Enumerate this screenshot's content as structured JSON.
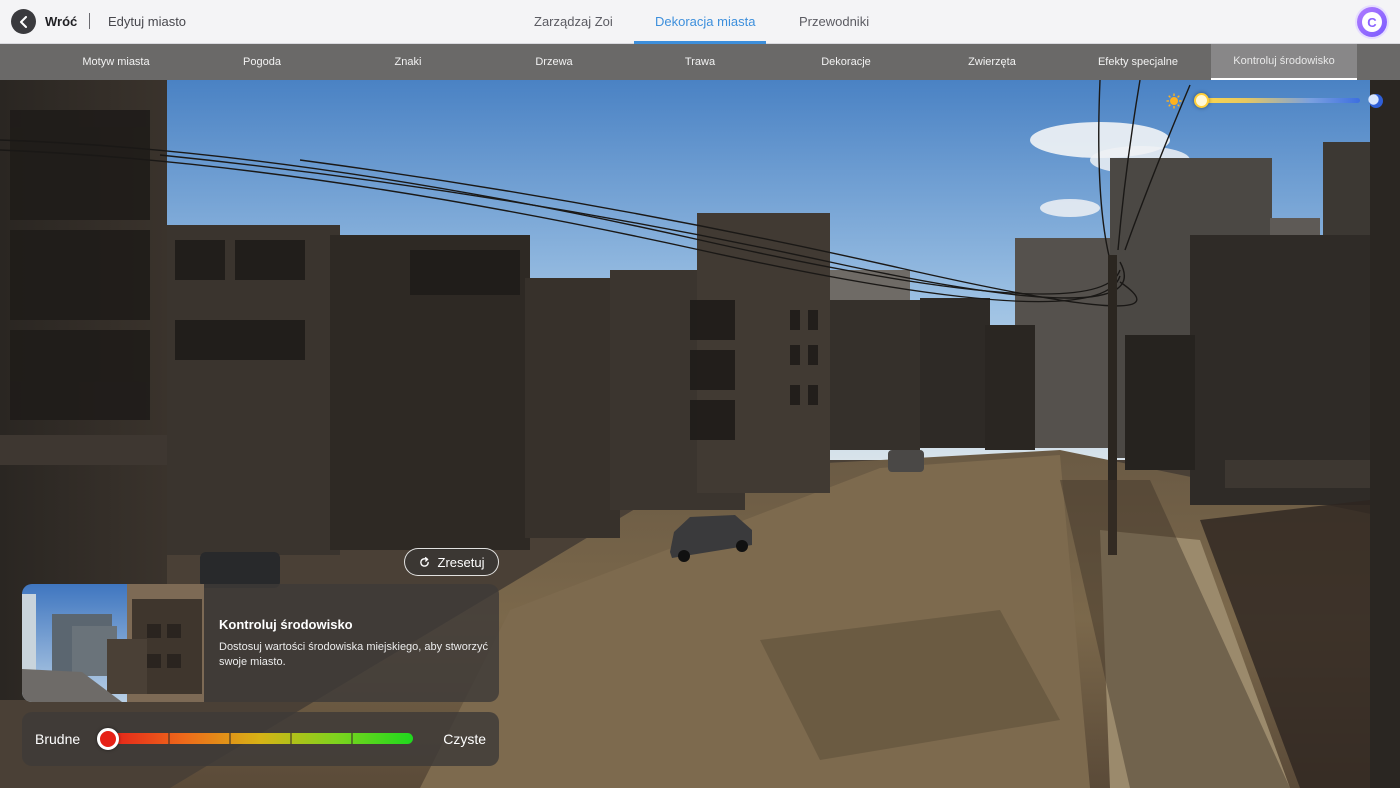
{
  "topbar": {
    "back_label": "Wróć",
    "breadcrumb": "Edytuj miasto",
    "tabs": [
      {
        "label": "Zarządzaj Zoi",
        "active": false
      },
      {
        "label": "Dekoracja miasta",
        "active": true
      },
      {
        "label": "Przewodniki",
        "active": false
      }
    ],
    "avatar_icon": "user-avatar-c-icon"
  },
  "subtabs": [
    {
      "label": "Motyw miasta",
      "active": false
    },
    {
      "label": "Pogoda",
      "active": false
    },
    {
      "label": "Znaki",
      "active": false
    },
    {
      "label": "Drzewa",
      "active": false
    },
    {
      "label": "Trawa",
      "active": false
    },
    {
      "label": "Dekoracje",
      "active": false
    },
    {
      "label": "Zwierzęta",
      "active": false
    },
    {
      "label": "Efekty specjalne",
      "active": false
    },
    {
      "label": "Kontroluj środowisko",
      "active": true
    }
  ],
  "time_slider": {
    "value_percent": 0,
    "left_icon": "sun-icon",
    "right_icon": "moon-icon"
  },
  "reset_button": {
    "label": "Zresetuj",
    "icon": "reset-icon"
  },
  "info_card": {
    "title": "Kontroluj środowisko",
    "description": "Dostosuj wartości środowiska miejskiego, aby stworzyć swoje miasto."
  },
  "cleanliness_slider": {
    "left_label": "Brudne",
    "right_label": "Czyste",
    "value_percent": 0,
    "steps": 5
  },
  "colors": {
    "accent": "#3d8fdc",
    "brand": "#8a62ff"
  }
}
